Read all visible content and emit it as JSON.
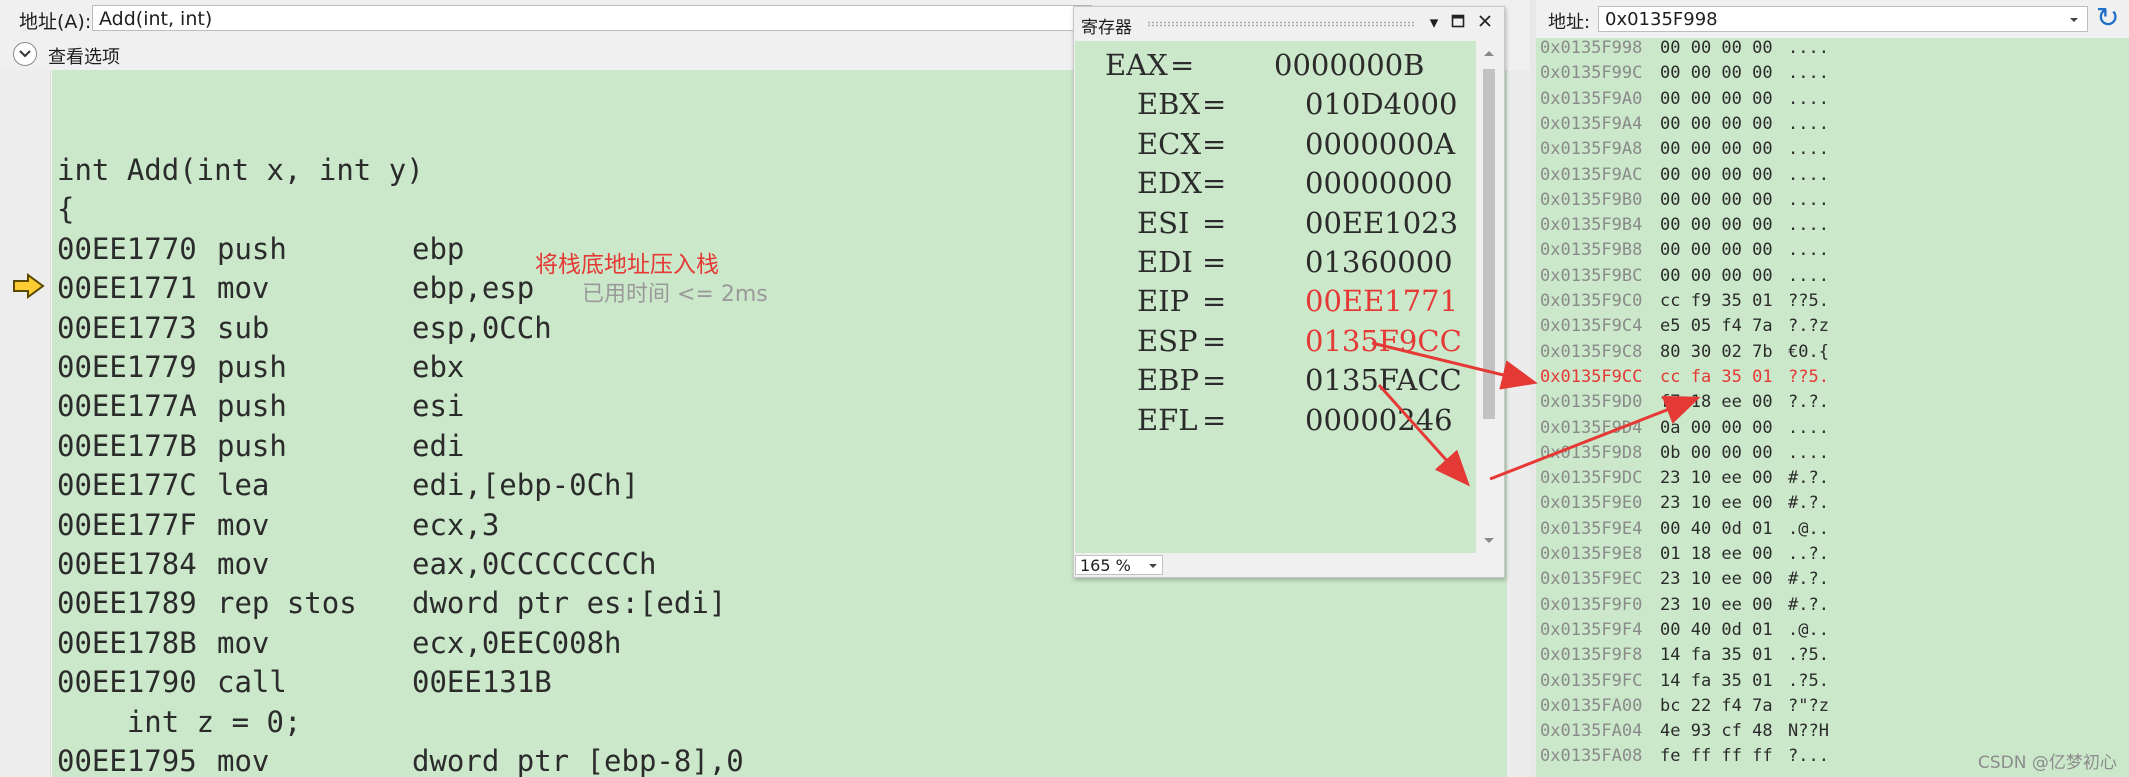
{
  "disassembly": {
    "address_label": "地址(A):",
    "address_value": "Add(int, int)",
    "view_options_label": "查看选项",
    "annotation": "将栈底地址压入栈",
    "elapsed": "已用时间 <= 2ms",
    "source_header": "int Add(int x, int y)",
    "brace": "{",
    "instructions_1": [
      {
        "addr": "00EE1770",
        "mnem": "push",
        "op": "ebp"
      },
      {
        "addr": "00EE1771",
        "mnem": "mov",
        "op": "ebp,esp"
      },
      {
        "addr": "00EE1773",
        "mnem": "sub",
        "op": "esp,0CCh"
      },
      {
        "addr": "00EE1779",
        "mnem": "push",
        "op": "ebx"
      },
      {
        "addr": "00EE177A",
        "mnem": "push",
        "op": "esi"
      },
      {
        "addr": "00EE177B",
        "mnem": "push",
        "op": "edi"
      },
      {
        "addr": "00EE177C",
        "mnem": "lea",
        "op": "edi,[ebp-0Ch]"
      },
      {
        "addr": "00EE177F",
        "mnem": "mov",
        "op": "ecx,3"
      },
      {
        "addr": "00EE1784",
        "mnem": "mov",
        "op": "eax,0CCCCCCCCh"
      },
      {
        "addr": "00EE1789",
        "mnem": "rep stos",
        "op": "dword ptr es:[edi]"
      },
      {
        "addr": "00EE178B",
        "mnem": "mov",
        "op": "ecx,0EEC008h"
      },
      {
        "addr": "00EE1790",
        "mnem": "call",
        "op": "00EE131B"
      }
    ],
    "source_line_2": "    int z = 0;",
    "instructions_2": [
      {
        "addr": "00EE1795",
        "mnem": "mov",
        "op": "dword ptr [ebp-8],0"
      }
    ],
    "current_instruction_index": 1
  },
  "registers": {
    "title": "寄存器",
    "zoom": "165 %",
    "items": [
      {
        "name": "EAX",
        "value": "0000000B",
        "changed": false
      },
      {
        "name": "EBX",
        "value": "010D4000",
        "changed": false
      },
      {
        "name": "ECX",
        "value": "0000000A",
        "changed": false
      },
      {
        "name": "EDX",
        "value": "00000000",
        "changed": false
      },
      {
        "name": "ESI",
        "value": "00EE1023",
        "changed": false
      },
      {
        "name": "EDI",
        "value": "01360000",
        "changed": false
      },
      {
        "name": "EIP",
        "value": "00EE1771",
        "changed": true
      },
      {
        "name": "ESP",
        "value": "0135F9CC",
        "changed": true
      },
      {
        "name": "EBP",
        "value": "0135FACC",
        "changed": false
      },
      {
        "name": "EFL",
        "value": "00000246",
        "changed": false
      }
    ]
  },
  "memory": {
    "address_label": "地址:",
    "address_value": "0x0135F998",
    "rows": [
      {
        "addr": "0x0135F998",
        "bytes": "00 00 00 00",
        "chars": "....",
        "changed": false
      },
      {
        "addr": "0x0135F99C",
        "bytes": "00 00 00 00",
        "chars": "....",
        "changed": false
      },
      {
        "addr": "0x0135F9A0",
        "bytes": "00 00 00 00",
        "chars": "....",
        "changed": false
      },
      {
        "addr": "0x0135F9A4",
        "bytes": "00 00 00 00",
        "chars": "....",
        "changed": false
      },
      {
        "addr": "0x0135F9A8",
        "bytes": "00 00 00 00",
        "chars": "....",
        "changed": false
      },
      {
        "addr": "0x0135F9AC",
        "bytes": "00 00 00 00",
        "chars": "....",
        "changed": false
      },
      {
        "addr": "0x0135F9B0",
        "bytes": "00 00 00 00",
        "chars": "....",
        "changed": false
      },
      {
        "addr": "0x0135F9B4",
        "bytes": "00 00 00 00",
        "chars": "....",
        "changed": false
      },
      {
        "addr": "0x0135F9B8",
        "bytes": "00 00 00 00",
        "chars": "....",
        "changed": false
      },
      {
        "addr": "0x0135F9BC",
        "bytes": "00 00 00 00",
        "chars": "....",
        "changed": false
      },
      {
        "addr": "0x0135F9C0",
        "bytes": "cc f9 35 01",
        "chars": "??5.",
        "changed": false
      },
      {
        "addr": "0x0135F9C4",
        "bytes": "e5 05 f4 7a",
        "chars": "?.?z",
        "changed": false
      },
      {
        "addr": "0x0135F9C8",
        "bytes": "80 30 02 7b",
        "chars": "€0.{",
        "changed": false
      },
      {
        "addr": "0x0135F9CC",
        "bytes": "cc fa 35 01",
        "chars": "??5.",
        "changed": true
      },
      {
        "addr": "0x0135F9D0",
        "bytes": "f7 18 ee 00",
        "chars": "?.?.",
        "changed": false
      },
      {
        "addr": "0x0135F9D4",
        "bytes": "0a 00 00 00",
        "chars": "....",
        "changed": false
      },
      {
        "addr": "0x0135F9D8",
        "bytes": "0b 00 00 00",
        "chars": "....",
        "changed": false
      },
      {
        "addr": "0x0135F9DC",
        "bytes": "23 10 ee 00",
        "chars": "#.?.",
        "changed": false
      },
      {
        "addr": "0x0135F9E0",
        "bytes": "23 10 ee 00",
        "chars": "#.?.",
        "changed": false
      },
      {
        "addr": "0x0135F9E4",
        "bytes": "00 40 0d 01",
        "chars": ".@..",
        "changed": false
      },
      {
        "addr": "0x0135F9E8",
        "bytes": "01 18 ee 00",
        "chars": "..?.",
        "changed": false
      },
      {
        "addr": "0x0135F9EC",
        "bytes": "23 10 ee 00",
        "chars": "#.?.",
        "changed": false
      },
      {
        "addr": "0x0135F9F0",
        "bytes": "23 10 ee 00",
        "chars": "#.?.",
        "changed": false
      },
      {
        "addr": "0x0135F9F4",
        "bytes": "00 40 0d 01",
        "chars": ".@..",
        "changed": false
      },
      {
        "addr": "0x0135F9F8",
        "bytes": "14 fa 35 01",
        "chars": ".?5.",
        "changed": false
      },
      {
        "addr": "0x0135F9FC",
        "bytes": "14 fa 35 01",
        "chars": ".?5.",
        "changed": false
      },
      {
        "addr": "0x0135FA00",
        "bytes": "bc 22 f4 7a",
        "chars": "?\"?z",
        "changed": false
      },
      {
        "addr": "0x0135FA04",
        "bytes": "4e 93 cf 48",
        "chars": "N??H",
        "changed": false
      },
      {
        "addr": "0x0135FA08",
        "bytes": "fe ff ff ff",
        "chars": "?...",
        "changed": false
      }
    ]
  },
  "watermark": "CSDN @亿梦初心",
  "colors": {
    "code_bg": "#cbe8cb",
    "changed": "#e53935",
    "annotation_arrow": "#e53935"
  }
}
